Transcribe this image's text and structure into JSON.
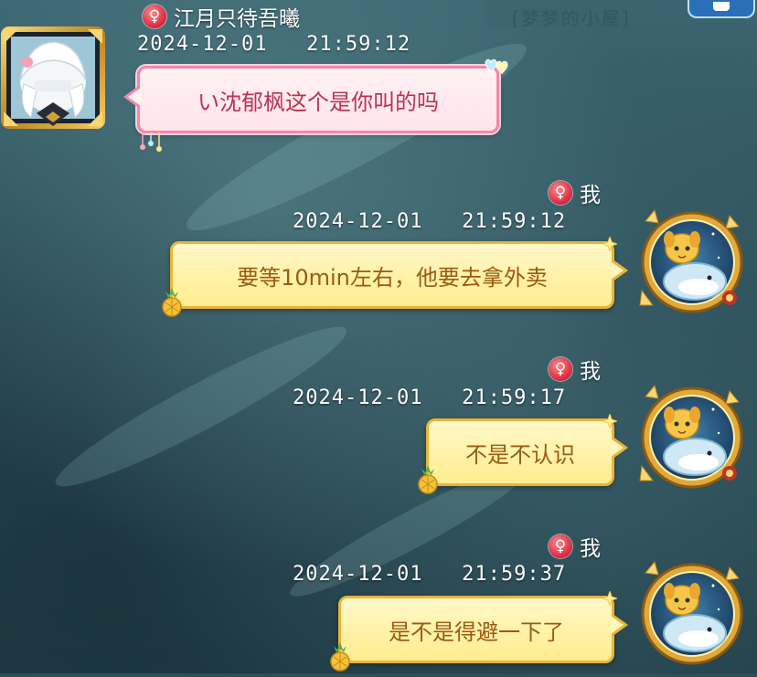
{
  "top_bar": {
    "faded_title": "[梦梦的小屋]"
  },
  "messages": [
    {
      "sender": "江月只待吾曦",
      "side": "left",
      "gender_icon": "female-symbol-icon",
      "gender_symbol": "♀",
      "timestamp": "2024-12-01   21:59:12",
      "text": "い沈郁枫这个是你叫的吗"
    },
    {
      "sender": "我",
      "side": "right",
      "gender_icon": "female-symbol-icon",
      "gender_symbol": "♀",
      "timestamp": "2024-12-01   21:59:12",
      "text": "要等10min左右，他要去拿外卖"
    },
    {
      "sender": "我",
      "side": "right",
      "gender_icon": "female-symbol-icon",
      "gender_symbol": "♀",
      "timestamp": "2024-12-01   21:59:17",
      "text": "不是不认识"
    },
    {
      "sender": "我",
      "side": "right",
      "gender_icon": "female-symbol-icon",
      "gender_symbol": "♀",
      "timestamp": "2024-12-01   21:59:37",
      "text": "是不是得避一下了"
    }
  ],
  "colors": {
    "left_bubble_border": "#f08aa6",
    "left_bubble_text": "#b8344f",
    "right_bubble_border": "#e9b43a",
    "right_bubble_text": "#9a5b12",
    "gender_icon": "#d7263d"
  }
}
